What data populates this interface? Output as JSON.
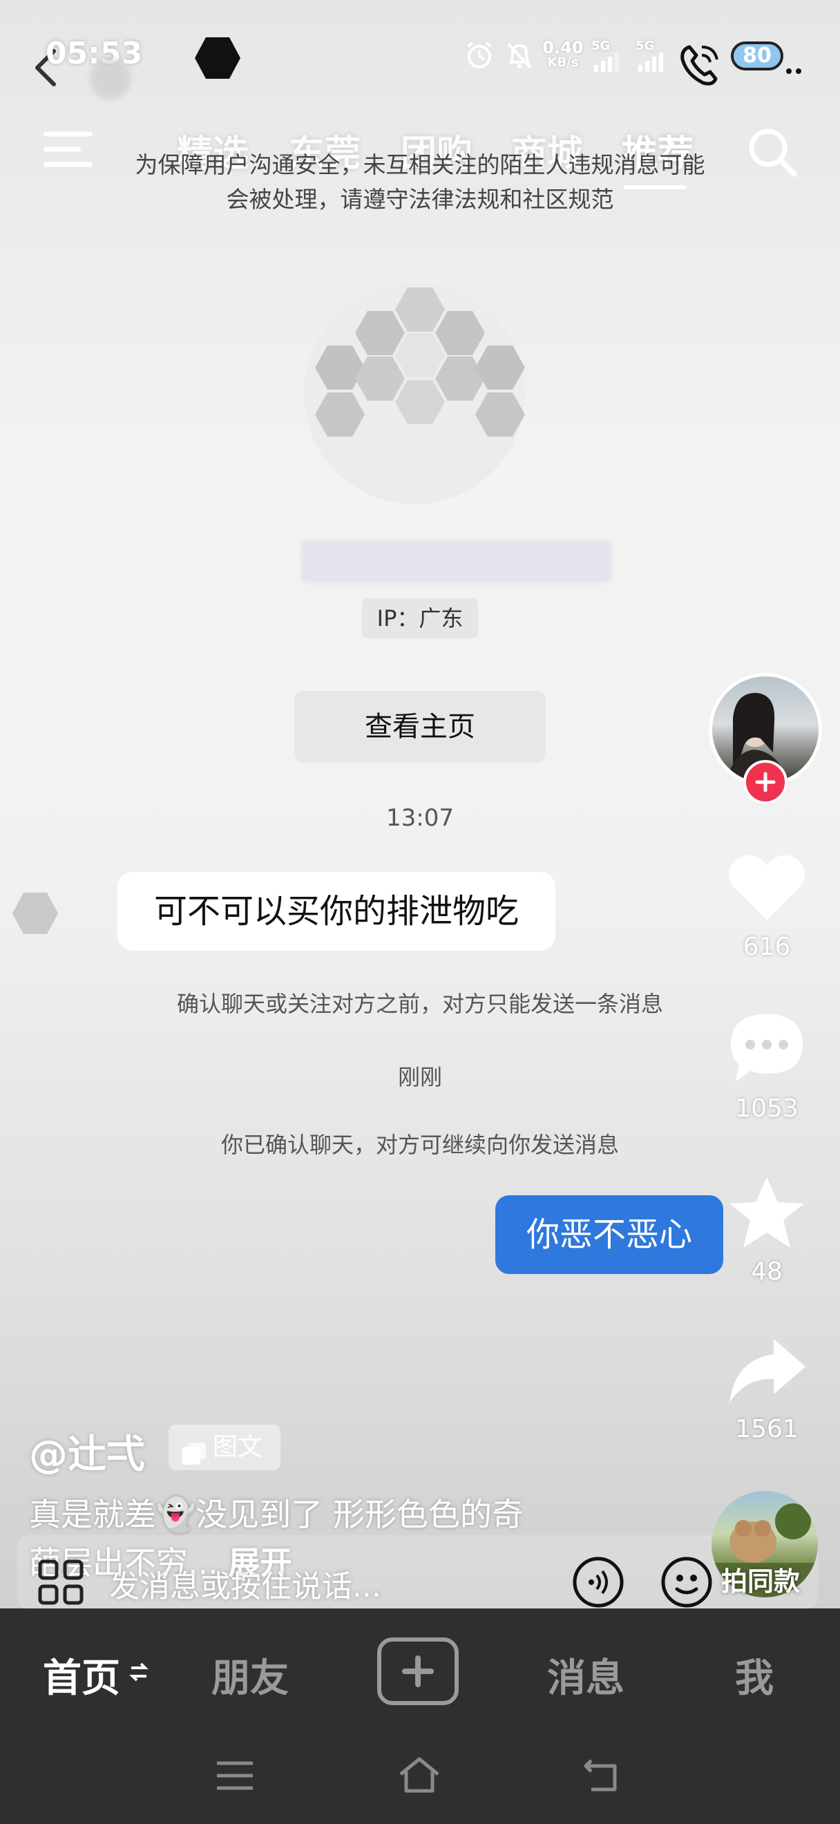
{
  "status_bar": {
    "time": "05:53",
    "net_speed_value": "0.40",
    "net_speed_unit": "KB/s",
    "signal_1": "5G",
    "signal_2": "5G",
    "battery": "80"
  },
  "top_tabs": {
    "items": [
      "精选",
      "东莞",
      "团购",
      "商城",
      "推荐"
    ],
    "active": "推荐"
  },
  "chat": {
    "safety_notice_line1": "为保障用户沟通安全，未互相关注的陌生人违规消息可能",
    "safety_notice_line2": "会被处理，请遵守法律法规和社区规范",
    "ip_label": "IP：广东",
    "view_profile_button": "查看主页",
    "timestamp_1": "13:07",
    "incoming_message": "可不可以买你的排泄物吃",
    "confirm_notice": "确认聊天或关注对方之前，对方只能发送一条消息",
    "timestamp_2": "刚刚",
    "confirmed_notice": "你已确认聊天，对方可继续向你发送消息",
    "outgoing_message": "你恶不恶心"
  },
  "side_actions": {
    "likes": "616",
    "comments": "1053",
    "favorites": "48",
    "shares": "1561"
  },
  "post": {
    "author": "@辻弌",
    "tag": "图文",
    "caption_line1": "真是就差👻没见到了  形形色色的奇",
    "caption_line2": "葩层出不穷...",
    "expand": "展开",
    "same_style_label": "拍同款",
    "message_placeholder": "发消息或按住说话..."
  },
  "bottom_nav": {
    "home": "首页",
    "friends": "朋友",
    "messages": "消息",
    "me": "我"
  },
  "colors": {
    "accent_blue": "#2f78dd",
    "follow_red": "#f0324e",
    "nav_bg": "#2f2f2f"
  }
}
